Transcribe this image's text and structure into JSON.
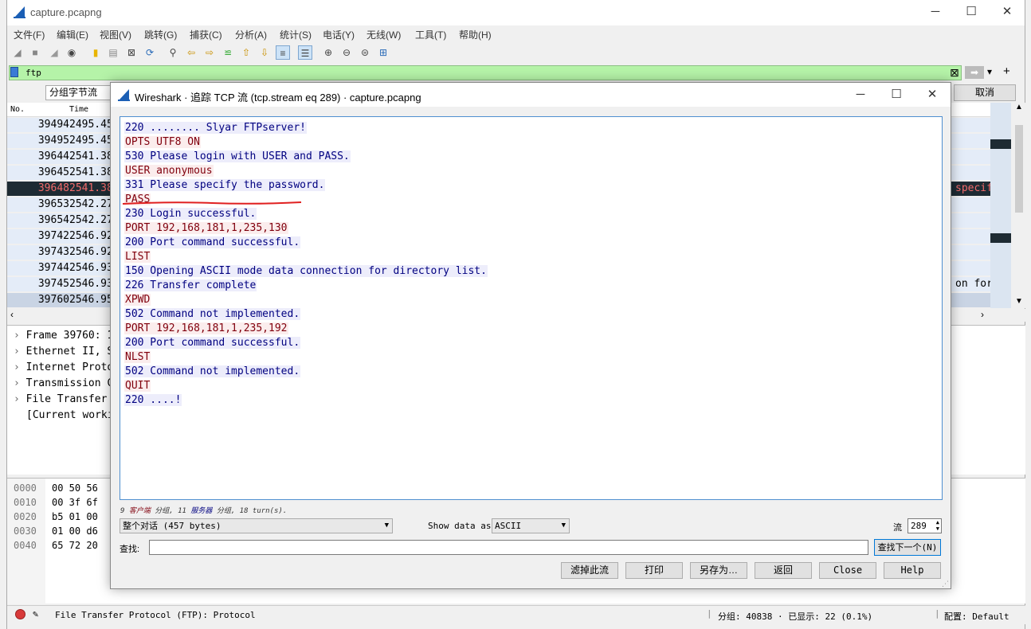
{
  "app": {
    "title": "capture.pcapng",
    "minimize": "─",
    "maximize": "☐",
    "close": "✕"
  },
  "menu": [
    "文件(F)",
    "编辑(E)",
    "视图(V)",
    "跳转(G)",
    "捕获(C)",
    "分析(A)",
    "统计(S)",
    "电话(Y)",
    "无线(W)",
    "工具(T)",
    "帮助(H)"
  ],
  "filter": {
    "value": "ftp",
    "clear_icon": "⊠",
    "apply_icon": "➡",
    "dropdown_icon": "▾",
    "add_icon": "+"
  },
  "secondary_bar": {
    "combo_label": "分组字节流",
    "cancel_button": "取消"
  },
  "packet_list": {
    "columns": [
      "No.",
      "Time"
    ],
    "rows": [
      {
        "no": "39494",
        "time": "2495.45",
        "extra": ""
      },
      {
        "no": "39495",
        "time": "2495.45",
        "extra": ""
      },
      {
        "no": "39644",
        "time": "2541.38",
        "extra": ""
      },
      {
        "no": "39645",
        "time": "2541.38",
        "extra": ""
      },
      {
        "no": "39648",
        "time": "2541.38",
        "extra": "specif"
      },
      {
        "no": "39653",
        "time": "2542.27",
        "extra": ""
      },
      {
        "no": "39654",
        "time": "2542.27",
        "extra": ""
      },
      {
        "no": "39742",
        "time": "2546.92",
        "extra": ""
      },
      {
        "no": "39743",
        "time": "2546.92",
        "extra": ""
      },
      {
        "no": "39744",
        "time": "2546.93",
        "extra": ""
      },
      {
        "no": "39745",
        "time": "2546.93",
        "extra": "on for"
      },
      {
        "no": "39760",
        "time": "2546.95",
        "extra": ""
      }
    ]
  },
  "details": [
    "Frame 39760: 1",
    "Ethernet II, S",
    "Internet Proto",
    "Transmission C",
    "File Transfer",
    "[Current worki"
  ],
  "bytes": {
    "offsets": [
      "0000",
      "0010",
      "0020",
      "0030",
      "0040"
    ],
    "hex": [
      "00 50 56",
      "00 3f 6f",
      "b5 01 00",
      "01 00 d6",
      "65 72 20"
    ]
  },
  "status": {
    "text": "File Transfer Protocol (FTP): Protocol",
    "packets": "分组: 40838 · 已显示: 22 (0.1%)",
    "profile": "配置: Default"
  },
  "dialog": {
    "title": "Wireshark · 追踪 TCP 流 (tcp.stream eq 289) · capture.pcapng",
    "lines": [
      {
        "dir": "srv",
        "text": "220 ........ Slyar FTPserver!"
      },
      {
        "dir": "cli",
        "text": "OPTS UTF8 ON"
      },
      {
        "dir": "srv",
        "text": "530 Please login with USER and PASS."
      },
      {
        "dir": "cli",
        "text": "USER anonymous"
      },
      {
        "dir": "srv",
        "text": "331 Please specify the password."
      },
      {
        "dir": "cli",
        "text": "PASS"
      },
      {
        "dir": "srv",
        "text": "230 Login successful."
      },
      {
        "dir": "cli",
        "text": "PORT 192,168,181,1,235,130"
      },
      {
        "dir": "srv",
        "text": "200 Port command successful."
      },
      {
        "dir": "cli",
        "text": "LIST"
      },
      {
        "dir": "srv",
        "text": "150 Opening ASCII mode data connection for directory list."
      },
      {
        "dir": "srv",
        "text": "226 Transfer complete"
      },
      {
        "dir": "cli",
        "text": "XPWD"
      },
      {
        "dir": "srv",
        "text": "502 Command not implemented."
      },
      {
        "dir": "cli",
        "text": "PORT 192,168,181,1,235,192"
      },
      {
        "dir": "srv",
        "text": "200 Port command successful."
      },
      {
        "dir": "cli",
        "text": "NLST"
      },
      {
        "dir": "srv",
        "text": "502 Command not implemented."
      },
      {
        "dir": "cli",
        "text": "QUIT"
      },
      {
        "dir": "srv",
        "text": "220 ....!"
      }
    ],
    "summary": {
      "client_count": "9",
      "client_label": "客户端",
      "sep1": "分组,",
      "server_count": "11",
      "server_label": "服务器",
      "sep2": "分组, 18 turn(s)."
    },
    "conversation": "整个对话 (457 bytes)",
    "show_data_label": "Show data as",
    "show_data_value": "ASCII",
    "stream_label": "流",
    "stream_value": "289",
    "find_label": "查找:",
    "find_value": "",
    "find_next": "查找下一个(N)",
    "buttons": {
      "filter_out": "滤掉此流",
      "print": "打印",
      "save_as": "另存为…",
      "back": "返回",
      "close": "Close",
      "help": "Help"
    }
  },
  "colors": {
    "client_text": "#80000d",
    "server_text": "#000080",
    "filter_bg": "#b5f3a8",
    "selected_row": "#1e2b33",
    "row_bg": "#e4ecf8"
  }
}
